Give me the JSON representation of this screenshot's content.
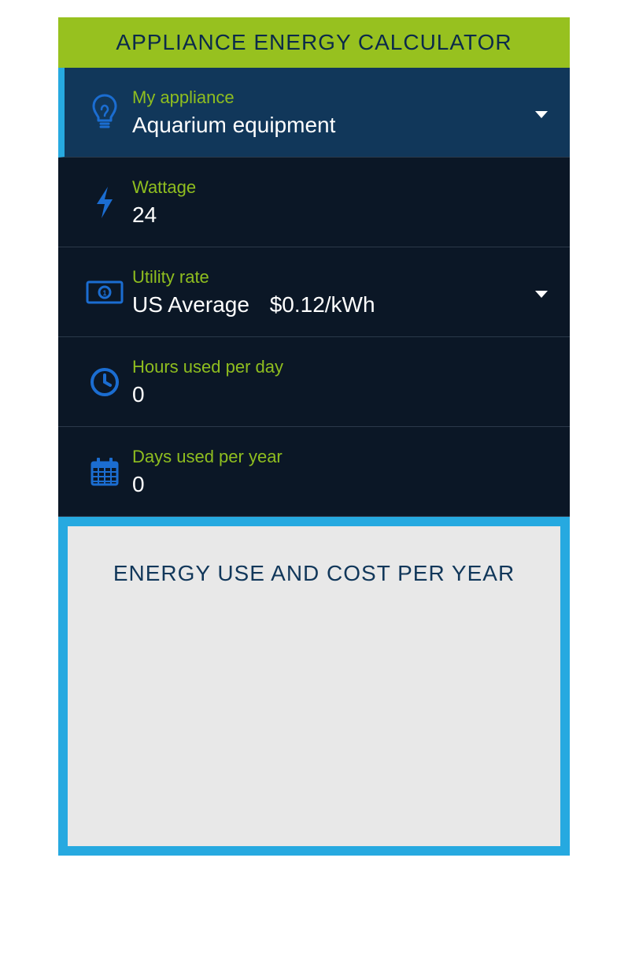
{
  "header": {
    "title": "APPLIANCE ENERGY CALCULATOR"
  },
  "rows": {
    "appliance": {
      "label": "My appliance",
      "value": "Aquarium equipment"
    },
    "wattage": {
      "label": "Wattage",
      "value": "24"
    },
    "utility_rate": {
      "label": "Utility rate",
      "value_region": "US Average",
      "value_rate": "$0.12/kWh"
    },
    "hours": {
      "label": "Hours used per day",
      "value": "0"
    },
    "days": {
      "label": "Days used per year",
      "value": "0"
    }
  },
  "results": {
    "title": "ENERGY USE AND COST PER YEAR"
  }
}
